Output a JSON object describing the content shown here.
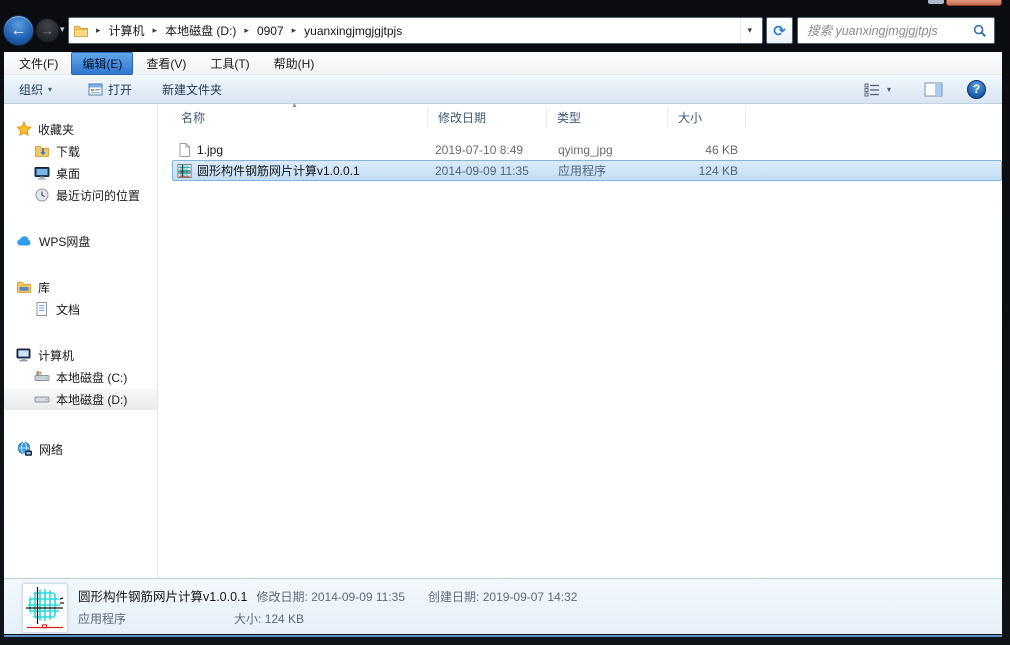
{
  "nav": {
    "breadcrumb_items": [
      "计算机",
      "本地磁盘 (D:)",
      "0907",
      "yuanxingjmgjgjtpjs"
    ],
    "search_placeholder": "搜索 yuanxingjmgjgjtpjs"
  },
  "menu_bar": {
    "items": [
      {
        "label": "文件(F)"
      },
      {
        "label": "编辑(E)"
      },
      {
        "label": "查看(V)"
      },
      {
        "label": "工具(T)"
      },
      {
        "label": "帮助(H)"
      }
    ]
  },
  "toolbar": {
    "organize_label": "组织",
    "open_label": "打开",
    "new_folder_label": "新建文件夹"
  },
  "file_list": {
    "columns": [
      {
        "label": "名称"
      },
      {
        "label": "修改日期"
      },
      {
        "label": "类型"
      },
      {
        "label": "大小"
      }
    ],
    "rows": [
      {
        "name": "1.jpg",
        "modified": "2019-07-10 8:49",
        "type": "qyimg_jpg",
        "size": "46 KB"
      },
      {
        "name": "圆形构件钢筋网片计算v1.0.0.1",
        "modified": "2014-09-09 11:35",
        "type": "应用程序",
        "size": "124 KB"
      }
    ]
  },
  "sidebar": {
    "favorites": {
      "label": "收藏夹",
      "items": [
        {
          "label": "下载"
        },
        {
          "label": "桌面"
        },
        {
          "label": "最近访问的位置"
        }
      ]
    },
    "wps": {
      "label": "WPS网盘"
    },
    "libraries": {
      "label": "库",
      "items": [
        {
          "label": "文档"
        }
      ]
    },
    "computer": {
      "label": "计算机",
      "items": [
        {
          "label": "本地磁盘 (C:)"
        },
        {
          "label": "本地磁盘 (D:)"
        }
      ]
    },
    "network": {
      "label": "网络"
    }
  },
  "details_pane": {
    "title": "圆形构件钢筋网片计算v1.0.0.1",
    "file_type": "应用程序",
    "modified_label": "修改日期:",
    "modified_value": "2014-09-09 11:35",
    "size_label": "大小:",
    "size_value": "124 KB",
    "created_label": "创建日期:",
    "created_value": "2019-09-07 14:32"
  },
  "glyphs": {
    "back_arrow": "←",
    "forward_arrow": "→",
    "chevron_down": "▾",
    "breadcrumb_separator": "▸",
    "refresh": "⟳",
    "sort_ascending": "▲",
    "help": "?"
  },
  "colors": {
    "selection_border": "#84b3dd",
    "selection_fill": "#c2ddf5",
    "menu_highlight": "#2e77d0",
    "toolbar_text": "#1f3b57",
    "chrome_dark": "#0a0c0f"
  }
}
